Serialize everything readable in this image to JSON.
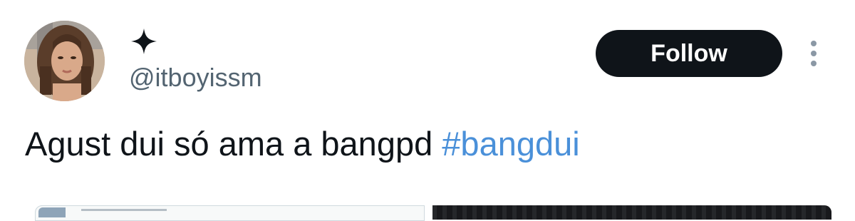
{
  "tweet": {
    "author": {
      "handle": "@itboyissm",
      "display_name_icon": "four-point-star-icon",
      "avatar_icon": "profile-photo"
    },
    "follow_label": "Follow",
    "more_icon": "vertical-ellipsis-icon",
    "text": {
      "body": "Agust dui só ama a bangpd ",
      "hashtag": "#bangdui"
    },
    "media": {
      "left": "link-preview-card",
      "right": "dark-image"
    }
  },
  "colors": {
    "text": "#0f1419",
    "secondary_text": "#536471",
    "hashtag": "#4a90d9",
    "follow_button_bg": "#0f1419",
    "follow_button_text": "#ffffff",
    "more_dots": "#8b98a5"
  }
}
